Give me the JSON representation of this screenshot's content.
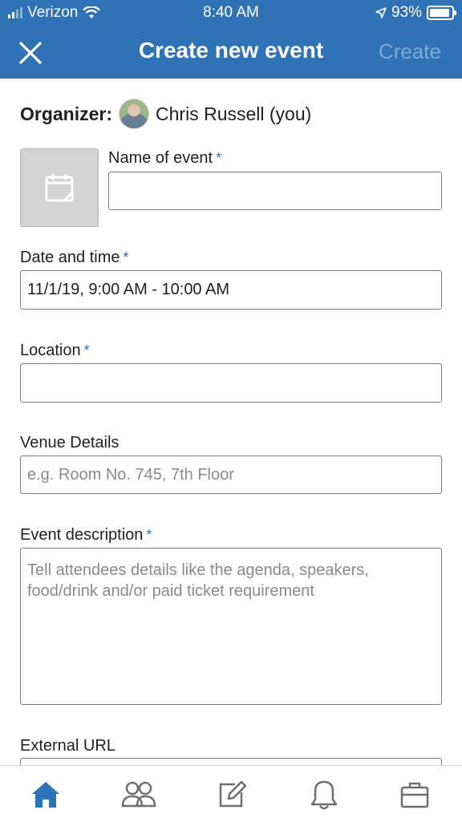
{
  "status_bar": {
    "carrier": "Verizon",
    "time": "8:40 AM",
    "battery": "93%"
  },
  "header": {
    "title": "Create new event",
    "create_label": "Create",
    "close_icon": "close-icon"
  },
  "organizer": {
    "label": "Organizer:",
    "name": "Chris Russell (you)"
  },
  "form": {
    "name_label": "Name of event",
    "name_value": "",
    "date_label": "Date and time",
    "date_value": "11/1/19, 9:00 AM - 10:00 AM",
    "location_label": "Location",
    "location_value": "",
    "venue_label": "Venue Details",
    "venue_placeholder": "e.g. Room No. 745, 7th Floor",
    "description_label": "Event description",
    "description_placeholder": "Tell attendees details like the agenda, speakers, food/drink and/or paid ticket requirement",
    "url_label": "External URL",
    "required_marker": "*"
  },
  "tabbar": {
    "items": [
      "home-icon",
      "my-network-icon",
      "post-icon",
      "notifications-icon",
      "jobs-icon"
    ],
    "active_color": "#2f72b6",
    "inactive_color": "#6f6f6f"
  }
}
